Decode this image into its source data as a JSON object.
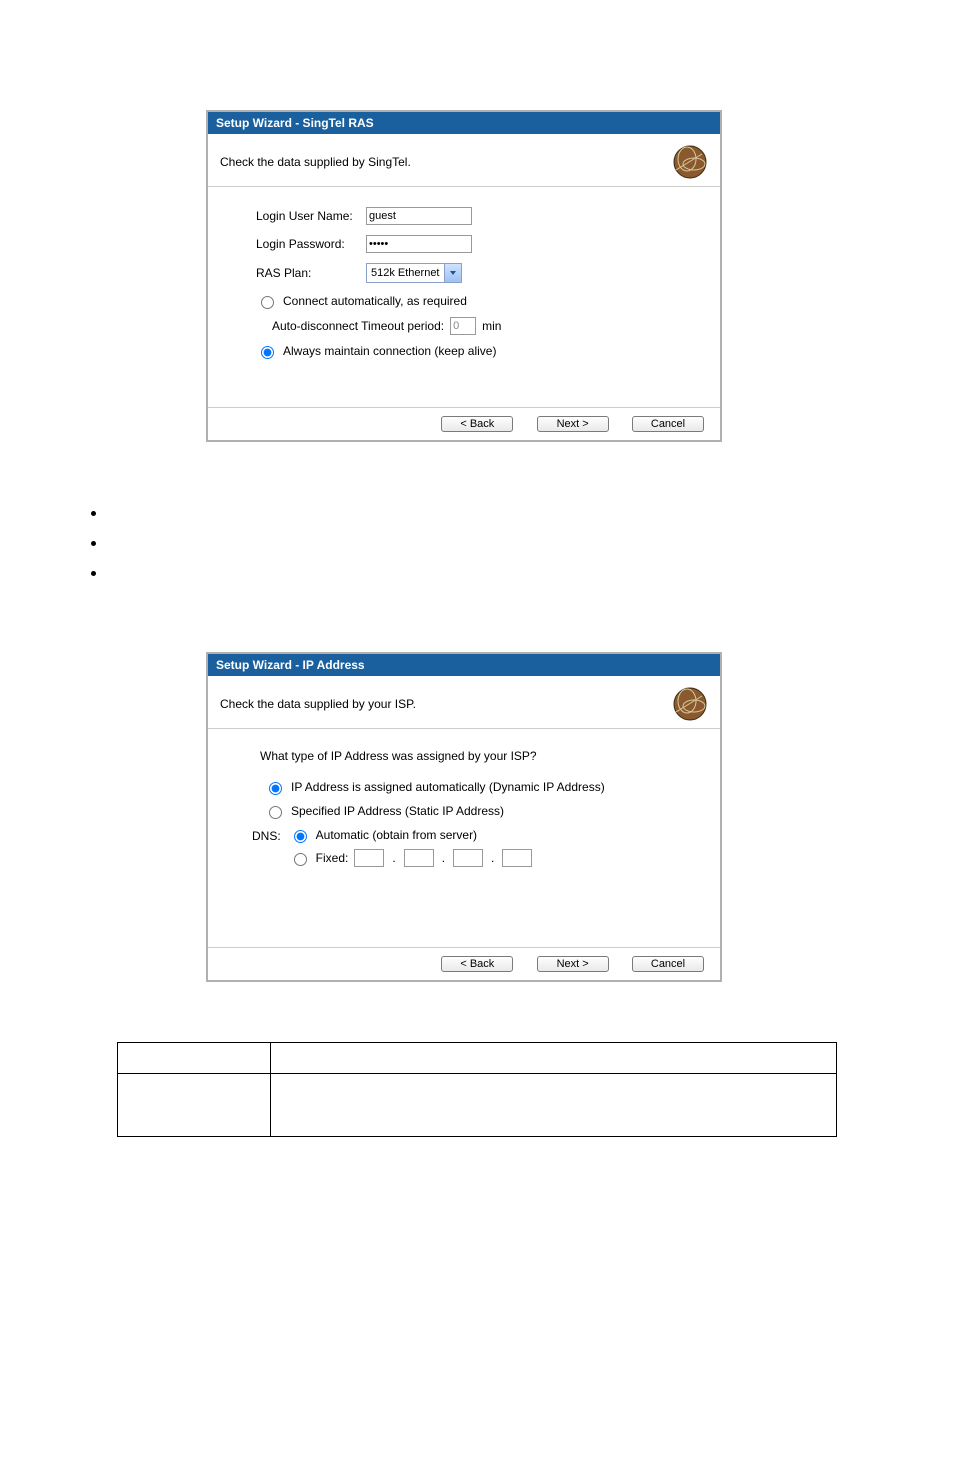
{
  "wizard1": {
    "title": "Setup Wizard - SingTel RAS",
    "desc": "Check the data supplied by SingTel.",
    "labels": {
      "login_user": "Login User Name:",
      "login_pass": "Login Password:",
      "ras_plan": "RAS Plan:",
      "connect_auto": "Connect automatically, as required",
      "auto_disc_label": "Auto-disconnect Timeout period:",
      "auto_disc_unit": "min",
      "keep_alive": "Always maintain connection (keep alive)"
    },
    "values": {
      "login_user": "guest",
      "login_pass": "•••••",
      "ras_plan": "512k Ethernet",
      "auto_disc": "0"
    },
    "buttons": {
      "back": "< Back",
      "next": "Next >",
      "cancel": "Cancel"
    }
  },
  "wizard2": {
    "title": "Setup Wizard - IP Address",
    "desc": "Check the data supplied by your ISP.",
    "heading": "What type of IP Address was assigned by your ISP?",
    "labels": {
      "dynamic": "IP Address is assigned automatically (Dynamic IP Address)",
      "static": "Specified IP Address (Static IP Address)",
      "dns": "DNS:",
      "dns_auto": "Automatic (obtain from server)",
      "dns_fixed": "Fixed:"
    },
    "buttons": {
      "back": "< Back",
      "next": "Next >",
      "cancel": "Cancel"
    }
  }
}
